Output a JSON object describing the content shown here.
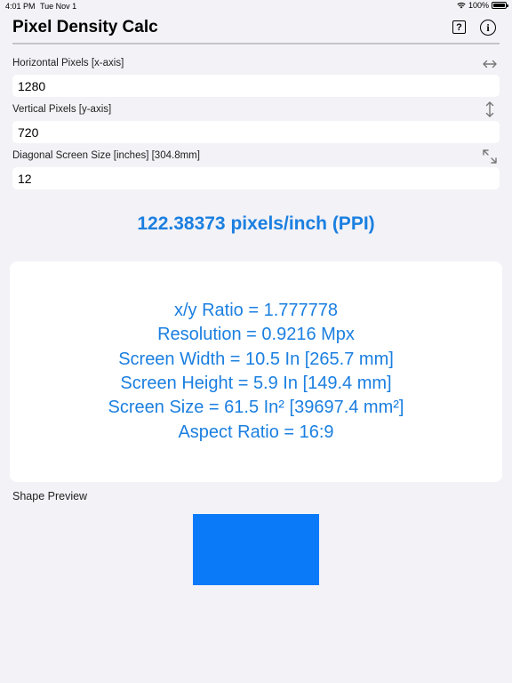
{
  "status_bar": {
    "time": "4:01 PM",
    "date": "Tue Nov 1",
    "battery": "100%"
  },
  "nav": {
    "title": "Pixel Density Calc",
    "help_label": "?",
    "info_label": "i"
  },
  "fields": {
    "horizontal": {
      "label": "Horizontal Pixels  [x-axis]",
      "value": "1280",
      "icon": "horizontal-arrows-icon"
    },
    "vertical": {
      "label": "Vertical Pixels [y-axis]",
      "value": "720",
      "icon": "vertical-arrows-icon"
    },
    "diagonal": {
      "label": "Diagonal Screen Size [inches] [304.8mm]",
      "value": "12",
      "icon": "diagonal-expand-icon"
    }
  },
  "result": {
    "ppi": "122.38373 pixels/inch (PPI)"
  },
  "stats": [
    "x/y Ratio = 1.777778",
    "Resolution = 0.9216 Mpx",
    "Screen Width = 10.5 In [265.7 mm]",
    "Screen Height = 5.9 In [149.4 mm]",
    "Screen Size = 61.5 In² [39697.4 mm²]",
    "Aspect Ratio = 16:9"
  ],
  "preview": {
    "label": "Shape Preview",
    "color": "#0a7af8"
  },
  "colors": {
    "accent": "#1b7fe0",
    "background": "#f2f2f7"
  }
}
